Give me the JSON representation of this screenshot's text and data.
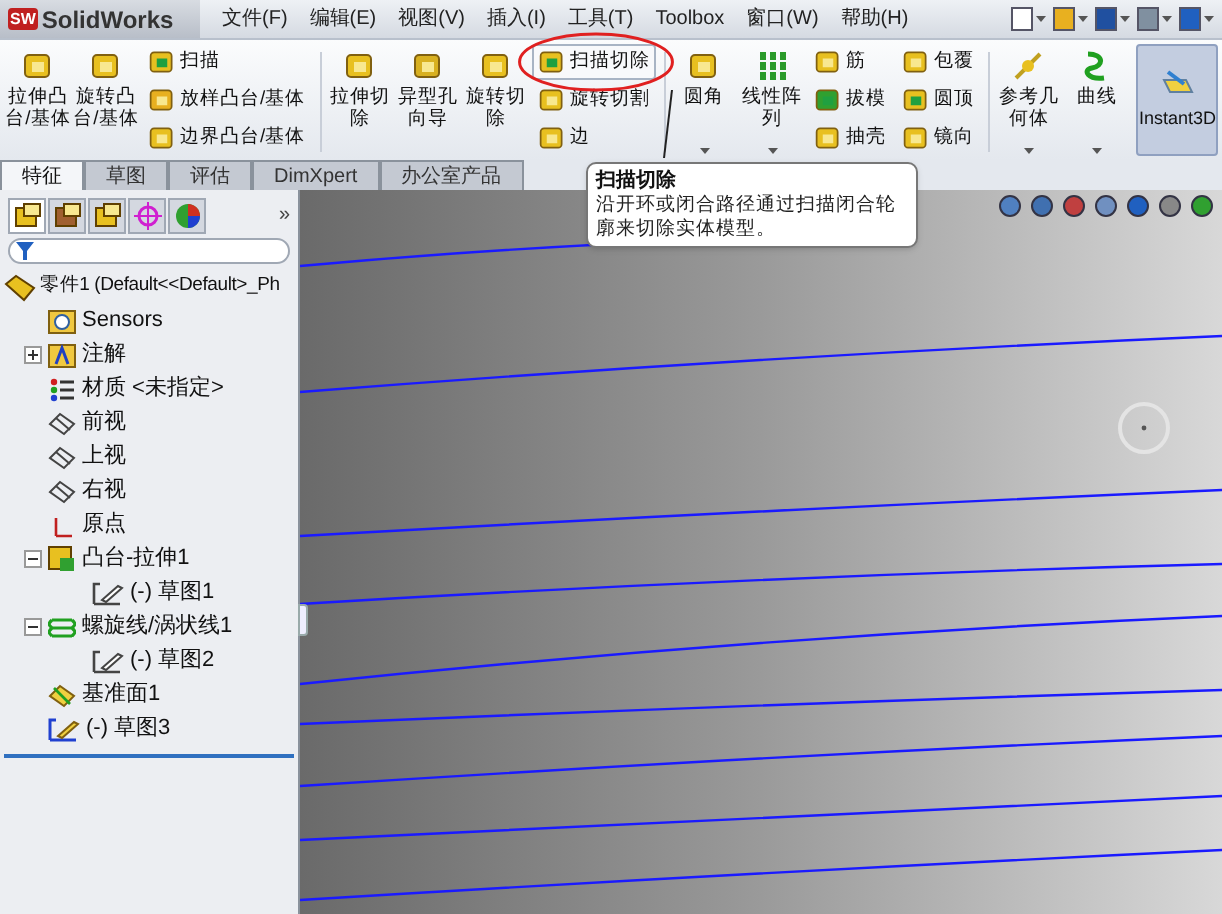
{
  "app": {
    "logo_badge": "SW",
    "logo_text": "SolidWorks"
  },
  "menus": [
    "文件(F)",
    "编辑(E)",
    "视图(V)",
    "插入(I)",
    "工具(T)",
    "Toolbox",
    "窗口(W)",
    "帮助(H)"
  ],
  "ribbon": [
    {
      "kind": "large",
      "label": "拉伸凸台/基体"
    },
    {
      "kind": "large",
      "label": "旋转凸台/基体"
    },
    {
      "kind": "stack",
      "items": [
        {
          "label": "扫描",
          "selected": false
        },
        {
          "label": "放样凸台/基体",
          "selected": false
        },
        {
          "label": "边界凸台/基体",
          "selected": false
        }
      ]
    },
    {
      "kind": "separator"
    },
    {
      "kind": "large",
      "label": "拉伸切除"
    },
    {
      "kind": "large",
      "label": "异型孔向导"
    },
    {
      "kind": "large",
      "label": "旋转切除"
    },
    {
      "kind": "stack",
      "items": [
        {
          "label": "扫描切除",
          "selected": true
        },
        {
          "label": "旋转切割",
          "selected": false
        },
        {
          "label": "边",
          "selected": false
        }
      ]
    },
    {
      "kind": "separator"
    },
    {
      "kind": "large",
      "label": "圆角",
      "dropdown": true
    },
    {
      "kind": "large",
      "label": "线性阵列",
      "dropdown": true
    },
    {
      "kind": "stack",
      "items": [
        {
          "label": "筋",
          "selected": false
        },
        {
          "label": "拔模",
          "selected": false
        },
        {
          "label": "抽壳",
          "selected": false
        }
      ]
    },
    {
      "kind": "stack",
      "items": [
        {
          "label": "包覆",
          "selected": false
        },
        {
          "label": "圆顶",
          "selected": false
        },
        {
          "label": "镜向",
          "selected": false
        }
      ]
    },
    {
      "kind": "separator"
    },
    {
      "kind": "large",
      "label": "参考几何体",
      "dropdown": true
    },
    {
      "kind": "large",
      "label": "曲线",
      "dropdown": true
    },
    {
      "kind": "toggle",
      "label": "Instant3D",
      "selected": true
    }
  ],
  "tabs": [
    {
      "label": "特征",
      "selected": true
    },
    {
      "label": "草图",
      "selected": false
    },
    {
      "label": "评估",
      "selected": false
    },
    {
      "label": "DimXpert",
      "selected": false
    },
    {
      "label": "办公室产品",
      "selected": false
    }
  ],
  "panel_tabs": [
    {
      "selected": true
    },
    {
      "selected": false
    },
    {
      "selected": false
    },
    {
      "selected": false
    },
    {
      "selected": false
    }
  ],
  "panel_more": "»",
  "tree": {
    "label": "零件1 (Default<<Default>_Ph",
    "children": [
      {
        "label": "Sensors"
      },
      {
        "label": "注解",
        "expanded": false
      },
      {
        "label": "材质 <未指定>"
      },
      {
        "label": "前视"
      },
      {
        "label": "上视"
      },
      {
        "label": "右视"
      },
      {
        "label": "原点"
      },
      {
        "label": "凸台-拉伸1",
        "expanded": true,
        "children": [
          {
            "label": "(-) 草图1"
          }
        ]
      },
      {
        "label": "螺旋线/涡状线1",
        "expanded": true,
        "children": [
          {
            "label": "(-) 草图2"
          }
        ]
      },
      {
        "label": "基准面1"
      },
      {
        "label": "(-) 草图3"
      }
    ]
  },
  "tooltip": {
    "title": "扫描切除",
    "body": "沿开环或闭合路径通过扫描闭合轮廓来切除实体模型。"
  }
}
